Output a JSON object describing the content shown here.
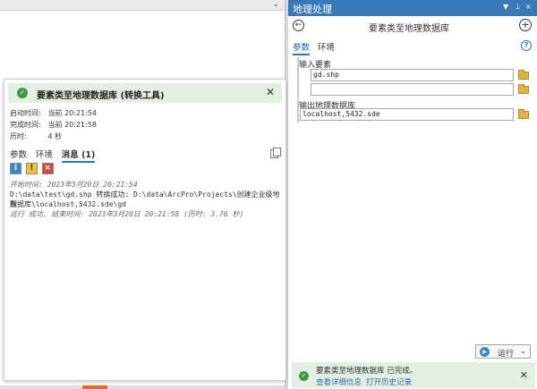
{
  "popup": {
    "title": "要素类至地理数据库 (转换工具)",
    "meta": [
      {
        "label": "启动时间:",
        "value": "当前 20:21:54"
      },
      {
        "label": "完成时间:",
        "value": "当前 20:21:58"
      },
      {
        "label": "历时:",
        "value": "4 秒"
      }
    ],
    "tabs": [
      "参数",
      "环境",
      "消息 (1)"
    ],
    "filters": {
      "info": "i",
      "warning": "!",
      "error": "×"
    },
    "messages": {
      "start": "开始时间: 2023年3月20日 20:21:54",
      "convert_line1": "D:\\data\\test\\gd.shp 转换成功:  D:\\data\\ArcPro\\Projects\\创建企业级地理",
      "convert_line2": "数据库\\localhost,5432.sde\\gd",
      "finish": "运行 成功, 结束时间:  2023年3月20日 20:21:58 (历时: 3.76 秒)"
    }
  },
  "gp": {
    "pane_title": "地理处理",
    "ctrl_menu": "▼",
    "ctrl_pin": "⊥",
    "ctrl_close": "×",
    "back": "←",
    "add": "+",
    "help": "?",
    "tool_title": "要素类至地理数据库",
    "tabs": [
      "参数",
      "环境"
    ],
    "input_label": "输入要素",
    "input_values": [
      "gd.shp",
      ""
    ],
    "output_label": "输出地理数据库",
    "output_value": "localhost,5432.sde",
    "run_label": "运行"
  },
  "status": {
    "message": "要素类至地理数据库 已完成。",
    "link1": "查看详细信息",
    "link2": "打开历史记录"
  },
  "colors": {
    "titlebar": "#3a79b7",
    "success_bg": "#e3efe1",
    "success_icon": "#3f9a41",
    "link": "#2a6fb5"
  }
}
